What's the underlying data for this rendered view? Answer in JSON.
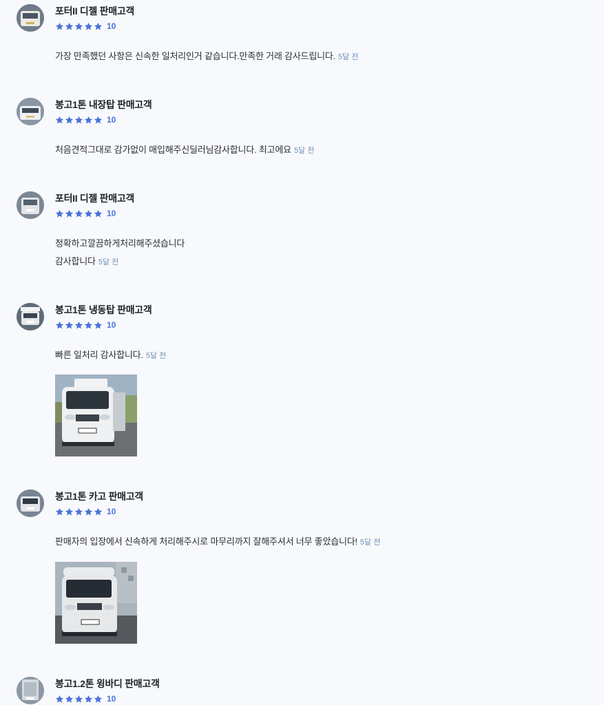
{
  "reviews": [
    {
      "customer": "포터II 디젤 판매고객",
      "score": "10",
      "stars": 5,
      "lines": [
        "가장 만족했던 사항은 신속한 일처리인거 같습니다.만족한 거래 감사드립니다."
      ],
      "time": "5달 전",
      "avatar_color": "#e8e6e0",
      "has_photo": false
    },
    {
      "customer": "봉고1톤 내장탑 판매고객",
      "score": "10",
      "stars": 5,
      "lines": [
        "처음견적그대로 감가없이 매입해주신딜러님감사합니다. 최고에요"
      ],
      "time": "5달 전",
      "avatar_color": "#e9ebee",
      "has_photo": false
    },
    {
      "customer": "포터II 디젤 판매고객",
      "score": "10",
      "stars": 5,
      "lines": [
        "정확하고깔끔하게처리해주셨습니다",
        "감사합니다"
      ],
      "time": "5달 전",
      "avatar_color": "#dfe2e6",
      "has_photo": false
    },
    {
      "customer": "봉고1톤 냉동탑 판매고객",
      "score": "10",
      "stars": 5,
      "lines": [
        "빠른 일처리 감사합니다."
      ],
      "time": "5달 전",
      "avatar_color": "#e6e8ea",
      "has_photo": true
    },
    {
      "customer": "봉고1톤 카고 판매고객",
      "score": "10",
      "stars": 5,
      "lines": [
        "판매자의 입장에서 신속하게 처리해주시로 마무리까지 잘해주셔서 너무 좋았습니다!"
      ],
      "time": "5달 전",
      "avatar_color": "#e3e5e8",
      "has_photo": true
    },
    {
      "customer": "봉고1.2톤 윙바디 판매고객",
      "score": "10",
      "stars": 5,
      "lines": [],
      "time": "",
      "avatar_color": "#cfd4da",
      "has_photo": false
    }
  ],
  "icons": {
    "star": "star-icon",
    "avatar": "vehicle-avatar"
  },
  "colors": {
    "star": "#4a72d9",
    "time": "#6e8fb6",
    "background": "#f8f9fc"
  }
}
